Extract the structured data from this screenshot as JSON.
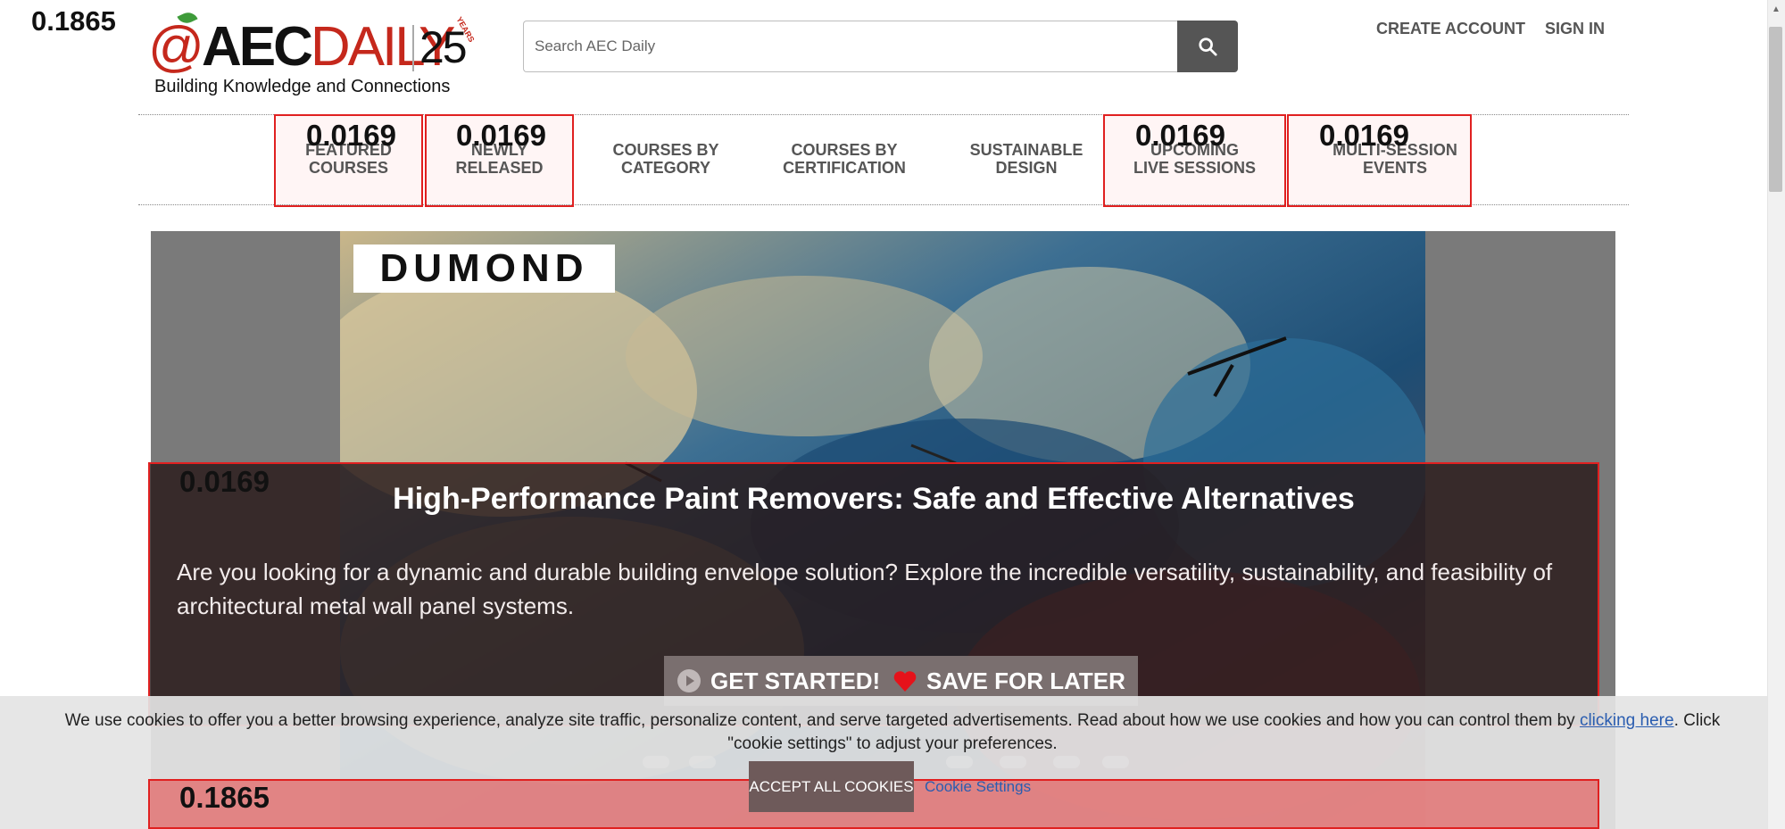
{
  "overlay_scores": {
    "page": "0.1865",
    "nav_featured": "0.0169",
    "nav_newly": "0.0169",
    "nav_upcoming": "0.0169",
    "nav_multi": "0.0169",
    "hero_panel": "0.0169",
    "bottom_box": "0.1865"
  },
  "logo": {
    "at": "@",
    "aec": "AEC",
    "daily": "DAILY",
    "anniversary": "25",
    "years": "YEARS",
    "tagline": "Building Knowledge and Connections"
  },
  "search": {
    "placeholder": "Search AEC Daily",
    "icon": "search-icon"
  },
  "header_links": {
    "create_account": "CREATE ACCOUNT",
    "sign_in": "SIGN IN"
  },
  "nav": {
    "featured_line1": "FEATURED",
    "featured_line2": "COURSES",
    "newly_line1": "NEWLY",
    "newly_line2": "RELEASED",
    "category_line1": "COURSES BY",
    "category_line2": "CATEGORY",
    "certification_line1": "COURSES BY",
    "certification_line2": "CERTIFICATION",
    "sustainable_line1": "SUSTAINABLE",
    "sustainable_line2": "DESIGN",
    "upcoming_line1": "UPCOMING",
    "upcoming_line2": "LIVE SESSIONS",
    "multi_line1": "MULTI-SESSION",
    "multi_line2": "EVENTS"
  },
  "hero": {
    "brand": "DUMOND",
    "title": "High-Performance Paint Removers: Safe and Effective Alternatives",
    "description": "Are you looking for a dynamic and durable building envelope solution? Explore the incredible versatility, sustainability, and feasibility of architectural metal wall panel systems.",
    "get_started": "GET STARTED!",
    "save_later": "SAVE FOR LATER"
  },
  "cookie": {
    "icon_glyph": "",
    "text_before": " We use cookies to offer you a better browsing experience, analyze site traffic, personalize content, and serve targeted advertisements. Read about how we use cookies and how you can control them by ",
    "link_text": "clicking here",
    "text_after": ". Click \"cookie settings\" to adjust your preferences.",
    "accept": "ACCEPT ALL COOKIES",
    "settings": "Cookie Settings"
  },
  "colors": {
    "brand_red": "#c5281c",
    "highlight_red": "#e02020",
    "link_blue": "#2a5db0"
  }
}
